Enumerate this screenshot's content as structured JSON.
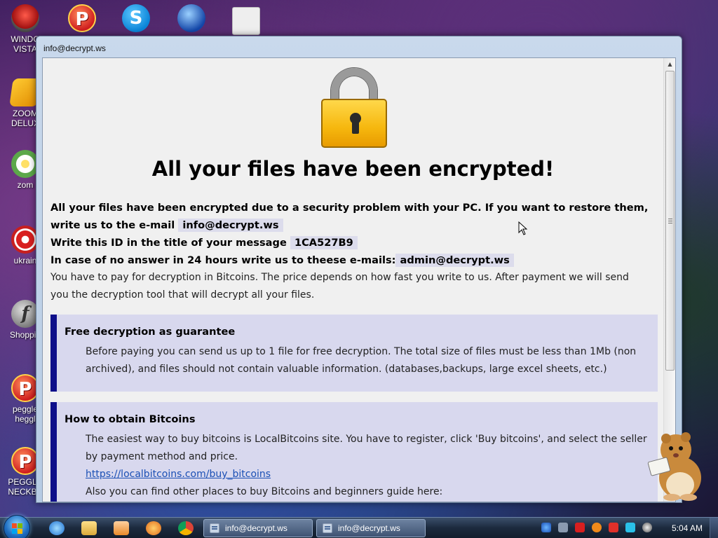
{
  "desktop": {
    "icons": [
      {
        "name": "windows-vista-icon",
        "label": "WINDO\nVISTA"
      },
      {
        "name": "peggle-top-icon",
        "label": ""
      },
      {
        "name": "skype-icon",
        "label": ""
      },
      {
        "name": "globe-app-icon",
        "label": ""
      },
      {
        "name": "card-icon",
        "label": ""
      },
      {
        "name": "zoom-deluxe-icon",
        "label": "ZOOM\nDELUX"
      },
      {
        "name": "zoom-icon",
        "label": "zom"
      },
      {
        "name": "ukraine-icon",
        "label": "ukrain"
      },
      {
        "name": "shopping-icon",
        "label": "Shoppin"
      },
      {
        "name": "peggle-heggle-icon",
        "label": "peggle\nheggl"
      },
      {
        "name": "peggle-neckbeard-icon",
        "label": "PEGGLE\nNECKBE"
      }
    ]
  },
  "window": {
    "title": "info@decrypt.ws",
    "headline": "All your files have been encrypted!",
    "intro_text": "All your files have been encrypted due to a security problem with your PC. If you want to restore them, write us to the e-mail",
    "email": "info@decrypt.ws",
    "id_text": "Write this ID in the title of your message",
    "id_value": "1CA527B9",
    "no_answer_text": "In case of no answer in 24 hours write us to theese e-mails:",
    "alt_email": "admin@decrypt.ws",
    "pay_text": "You have to pay for decryption in Bitcoins. The price depends on how fast you write to us. After payment we will send you the decryption tool that will decrypt all your files.",
    "guarantee": {
      "heading": "Free decryption as guarantee",
      "body": "Before paying you can send us up to 1 file for free decryption. The total size of files must be less than 1Mb (non archived), and files should not contain valuable information. (databases,backups, large excel sheets, etc.)"
    },
    "bitcoins": {
      "heading": "How to obtain Bitcoins",
      "body": "The easiest way to buy bitcoins is LocalBitcoins site. You have to register, click 'Buy bitcoins', and select the seller by payment method and price.",
      "link": "https://localbitcoins.com/buy_bitcoins",
      "more": "Also you can find other places to buy Bitcoins and beginners guide here:"
    }
  },
  "taskbar": {
    "tasks": [
      {
        "label": "info@decrypt.ws"
      },
      {
        "label": "info@decrypt.ws"
      }
    ],
    "clock": "5:04 AM"
  },
  "colors": {
    "box_accent": "#0e0f8a",
    "box_background": "#d8d8ee",
    "link": "#1a4fb5"
  }
}
